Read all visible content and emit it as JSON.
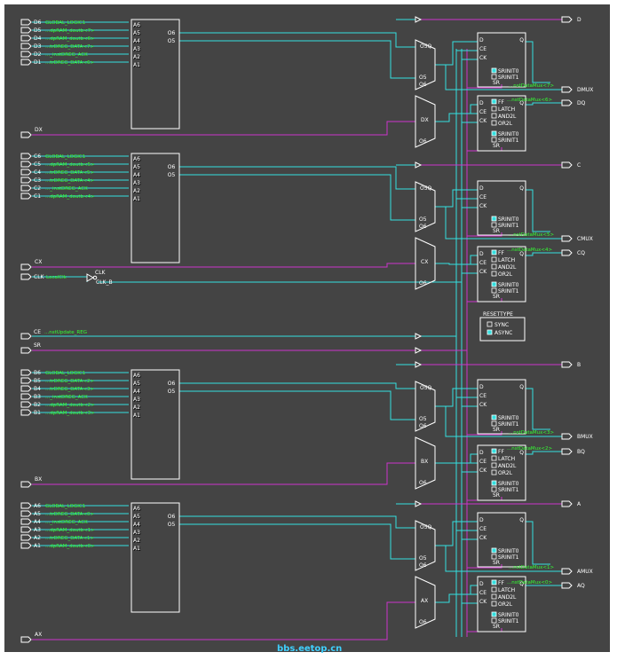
{
  "slice_outputs": [
    "D",
    "DMUX",
    "DQ",
    "C",
    "CMUX",
    "CQ",
    "B",
    "BMUX",
    "BQ",
    "A",
    "AMUX",
    "AQ"
  ],
  "luts": [
    {
      "name": "D6",
      "func": "GLOBAL_LOGIC1",
      "ins": [
        "A6",
        "A5",
        "A4",
        "A3",
        "A2",
        "A1"
      ],
      "pins": [
        "D5",
        "D4",
        "D3",
        "D2",
        "D1"
      ],
      "nets": [
        "...dpRAM_doutb<7>",
        "...dpRAM_doutb<6>",
        "...trDREG_DATA<7>",
        "..._instDREG_ACK",
        "...trDREG_DATA<6>"
      ],
      "outs": [
        "O6",
        "O5"
      ]
    },
    {
      "name": "C6",
      "func": "GLOBAL_LOGIC1",
      "ins": [
        "A6",
        "A5",
        "A4",
        "A3",
        "A2",
        "A1"
      ],
      "pins": [
        "C5",
        "C4",
        "C3",
        "C2",
        "C1"
      ],
      "nets": [
        "...dpRAM_doutb<5>",
        "...trDREG_DATA<5>",
        "...trDREG_DATA<4>",
        "..._instDREG_ACK",
        "...dpRAM_doutb<4>"
      ],
      "outs": [
        "O6",
        "O5"
      ]
    },
    {
      "name": "B6",
      "func": "GLOBAL_LOGIC1",
      "ins": [
        "A6",
        "A5",
        "A4",
        "A3",
        "A2",
        "A1"
      ],
      "pins": [
        "B5",
        "B4",
        "B3",
        "B2",
        "B1"
      ],
      "nets": [
        "...trDREG_DATA<2>",
        "...trDREG_DATA<3>",
        "..._instDREG_ACK",
        "...dpRAM_doutb<2>",
        "...dpRAM_doutb<3>"
      ],
      "outs": [
        "O6",
        "O5"
      ]
    },
    {
      "name": "A6",
      "func": "GLOBAL_LOGIC1",
      "ins": [
        "A6",
        "A5",
        "A4",
        "A3",
        "A2",
        "A1"
      ],
      "pins": [
        "A5",
        "A4",
        "A3",
        "A2",
        "A1"
      ],
      "nets": [
        "...trDREG_DATA<0>",
        "..._instDREG_ACK",
        "...dpRAM_doutb<1>",
        "...trDREG_DATA<1>",
        "...dpRAM_doutb<0>"
      ],
      "outs": [
        "O6",
        "O5"
      ]
    }
  ],
  "bypass": [
    "DX",
    "CX",
    "BX",
    "AX"
  ],
  "ctrl": {
    "clk": "CLK",
    "clk_net": "LocalClk",
    "clk_inv": [
      "CLK",
      "CLK_B"
    ],
    "ce": "CE",
    "ce_net": "...nstUpdate_REG",
    "sr": "SR"
  },
  "mux_labels": {
    "o5": "O5",
    "o6": "O6"
  },
  "ff_pins": {
    "d": "D",
    "q": "Q",
    "ce": "CE",
    "ck": "CK",
    "sr": "SR",
    "srinit0": "SRINIT0",
    "srinit1": "SRINIT1",
    "ff": "FF",
    "latch": "LATCH",
    "and2l": "AND2L",
    "or2l": "OR2L"
  },
  "mux_nets": [
    "...nstDataMux<7>",
    "...nstDataMux<6>",
    "...nstDataMux<5>",
    "...nstDataMux<4>",
    "...nstDataMux<3>",
    "...nstDataMux<2>",
    "...nstDataMux<1>",
    "...nstDataMux<0>"
  ],
  "resettype": {
    "title": "RESETTYPE",
    "options": [
      "SYNC",
      "ASYNC"
    ]
  },
  "watermark": "bbs.eetop.cn",
  "colors": {
    "bg": "#444444",
    "cyan": "#33e0e0",
    "magenta": "#cc33cc",
    "green": "#33ff33",
    "box": "#ffffff"
  }
}
